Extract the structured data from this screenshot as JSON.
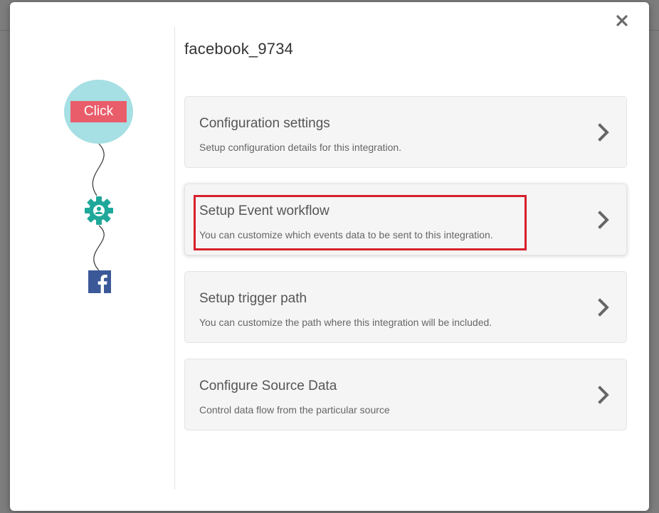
{
  "modal": {
    "title": "facebook_9734",
    "close_icon": "close-x-icon"
  },
  "flow": {
    "trigger_label": "Click",
    "steps": [
      {
        "icon": "gear-icon",
        "color": "#1fa89a"
      },
      {
        "icon": "facebook-icon",
        "color": "#3b5998"
      }
    ],
    "trigger_color": "#a6dfe4",
    "trigger_label_bg": "#e95d6b"
  },
  "cards": [
    {
      "title": "Configuration settings",
      "description": "Setup configuration details for this integration."
    },
    {
      "title": "Setup Event workflow",
      "description": "You can customize which events data to be sent to this integration.",
      "highlighted": true
    },
    {
      "title": "Setup trigger path",
      "description": "You can customize the path where this integration will be included."
    },
    {
      "title": "Configure Source Data",
      "description": "Control data flow from the particular source"
    }
  ],
  "colors": {
    "highlight_border": "#d7202b",
    "card_bg": "#f5f5f5",
    "arrow": "#666666"
  }
}
